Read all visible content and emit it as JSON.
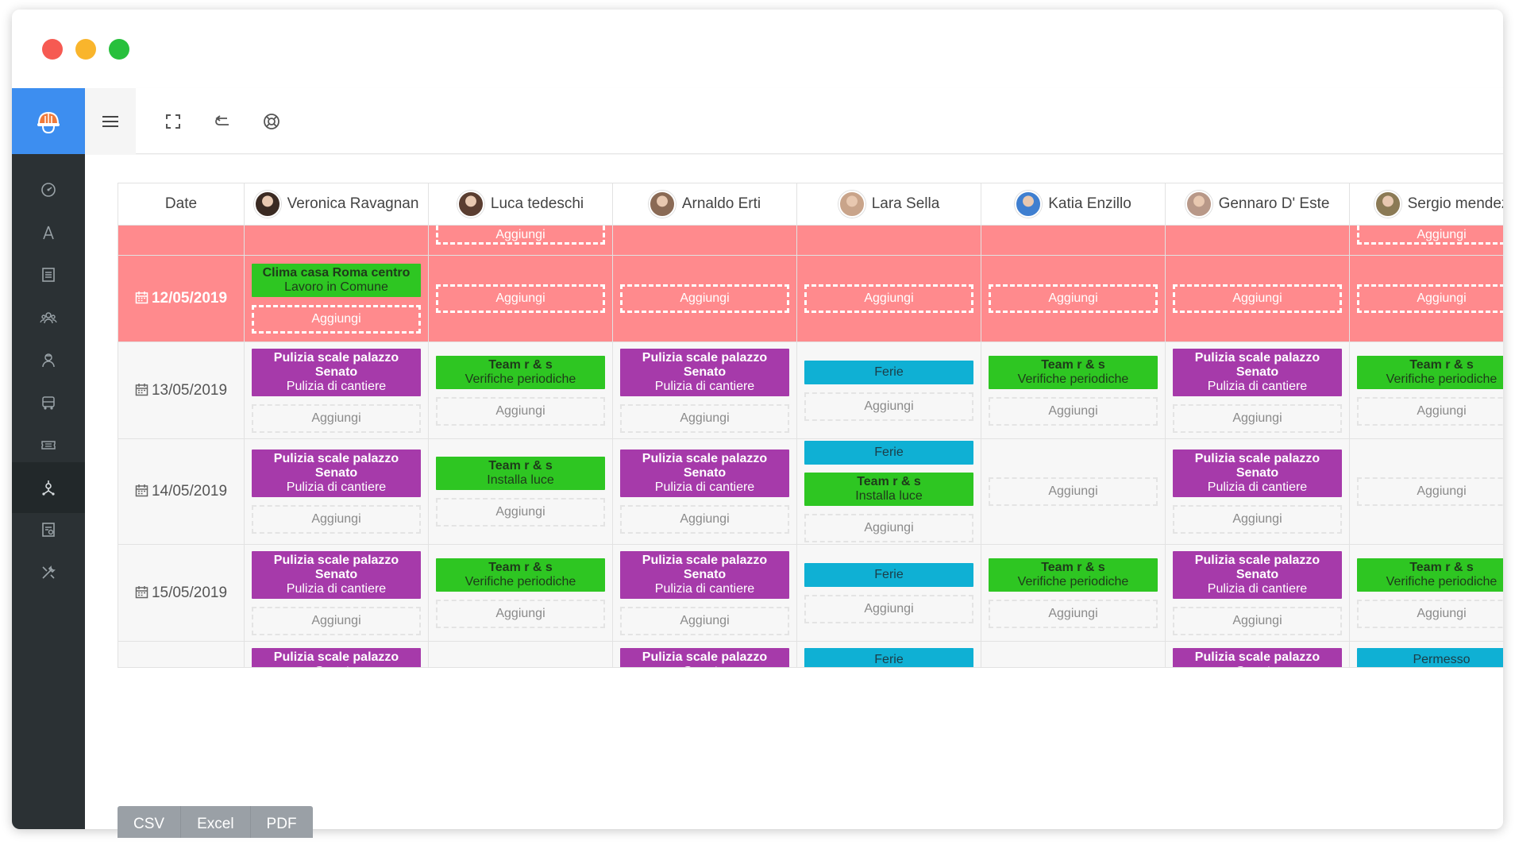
{
  "window": {
    "controls": [
      "close",
      "minimize",
      "maximize"
    ]
  },
  "sidebar": {
    "brand_icon": "helmet-icon",
    "items": [
      {
        "name": "dashboard",
        "icon": "gauge-icon"
      },
      {
        "name": "tools",
        "icon": "compass-icon"
      },
      {
        "name": "documents",
        "icon": "list-icon"
      },
      {
        "name": "team",
        "icon": "group-icon"
      },
      {
        "name": "workers",
        "icon": "worker-icon"
      },
      {
        "name": "vehicles",
        "icon": "truck-icon"
      },
      {
        "name": "tickets",
        "icon": "ticket-icon"
      },
      {
        "name": "planning",
        "icon": "org-icon",
        "active": true
      },
      {
        "name": "reports",
        "icon": "report-icon"
      },
      {
        "name": "settings",
        "icon": "wrench-icon"
      }
    ]
  },
  "toolbar": {
    "icons": [
      "menu-icon",
      "fullscreen-icon",
      "undo-icon",
      "support-icon"
    ]
  },
  "table": {
    "date_header": "Date",
    "employees": [
      {
        "name": "Veronica Ravagnan",
        "avatar_color": "#3a2a22"
      },
      {
        "name": "Luca tedeschi",
        "avatar_color": "#5a3d30"
      },
      {
        "name": "Arnaldo Erti",
        "avatar_color": "#8a6a55"
      },
      {
        "name": "Lara Sella",
        "avatar_color": "#c9a48a"
      },
      {
        "name": "Katia Enzillo",
        "avatar_color": "#3f7fd0"
      },
      {
        "name": "Gennaro D' Este",
        "avatar_color": "#b89888"
      },
      {
        "name": "Sergio mendez",
        "avatar_color": "#8b7a55"
      }
    ],
    "add_label": "Aggiungi",
    "rows": [
      {
        "date": "",
        "style": "red",
        "cells": [
          {
            "events": [],
            "add": false
          },
          {
            "events": [],
            "add": true,
            "add_top": true
          },
          {
            "events": [],
            "add": false
          },
          {
            "events": [],
            "add": false
          },
          {
            "events": [],
            "add": false
          },
          {
            "events": [],
            "add": false
          },
          {
            "events": [],
            "add": true,
            "add_top": true
          }
        ]
      },
      {
        "date": "12/05/2019",
        "style": "red",
        "cells": [
          {
            "events": [
              {
                "color": "green",
                "title": "Clima casa Roma centro",
                "sub": "Lavoro in Comune"
              }
            ],
            "add": true
          },
          {
            "events": [],
            "add": true
          },
          {
            "events": [],
            "add": true
          },
          {
            "events": [],
            "add": true
          },
          {
            "events": [],
            "add": true
          },
          {
            "events": [],
            "add": true
          },
          {
            "events": [],
            "add": true
          }
        ]
      },
      {
        "date": "13/05/2019",
        "style": "normal",
        "cells": [
          {
            "events": [
              {
                "color": "purple",
                "title": "Pulizia scale palazzo Senato",
                "sub": "Pulizia di cantiere"
              }
            ],
            "add": true
          },
          {
            "events": [
              {
                "color": "green",
                "title": "Team r & s",
                "sub": "Verifiche periodiche"
              }
            ],
            "add": true
          },
          {
            "events": [
              {
                "color": "purple",
                "title": "Pulizia scale palazzo Senato",
                "sub": "Pulizia di cantiere"
              }
            ],
            "add": true
          },
          {
            "events": [
              {
                "color": "cyan",
                "title": "",
                "sub": "Ferie"
              }
            ],
            "add": true
          },
          {
            "events": [
              {
                "color": "green",
                "title": "Team r & s",
                "sub": "Verifiche periodiche"
              }
            ],
            "add": true
          },
          {
            "events": [
              {
                "color": "purple",
                "title": "Pulizia scale palazzo Senato",
                "sub": "Pulizia di cantiere"
              }
            ],
            "add": true
          },
          {
            "events": [
              {
                "color": "green",
                "title": "Team r & s",
                "sub": "Verifiche periodiche"
              }
            ],
            "add": true
          }
        ]
      },
      {
        "date": "14/05/2019",
        "style": "normal",
        "cells": [
          {
            "events": [
              {
                "color": "purple",
                "title": "Pulizia scale palazzo Senato",
                "sub": "Pulizia di cantiere"
              }
            ],
            "add": true
          },
          {
            "events": [
              {
                "color": "green",
                "title": "Team r & s",
                "sub": "Installa luce"
              }
            ],
            "add": true
          },
          {
            "events": [
              {
                "color": "purple",
                "title": "Pulizia scale palazzo Senato",
                "sub": "Pulizia di cantiere"
              }
            ],
            "add": true
          },
          {
            "events": [
              {
                "color": "cyan",
                "title": "",
                "sub": "Ferie"
              },
              {
                "color": "green",
                "title": "Team r & s",
                "sub": "Installa luce"
              }
            ],
            "add": true
          },
          {
            "events": [],
            "add": true
          },
          {
            "events": [
              {
                "color": "purple",
                "title": "Pulizia scale palazzo Senato",
                "sub": "Pulizia di cantiere"
              }
            ],
            "add": true
          },
          {
            "events": [],
            "add": true
          }
        ]
      },
      {
        "date": "15/05/2019",
        "style": "normal",
        "cells": [
          {
            "events": [
              {
                "color": "purple",
                "title": "Pulizia scale palazzo Senato",
                "sub": "Pulizia di cantiere"
              }
            ],
            "add": true
          },
          {
            "events": [
              {
                "color": "green",
                "title": "Team r & s",
                "sub": "Verifiche periodiche"
              }
            ],
            "add": true
          },
          {
            "events": [
              {
                "color": "purple",
                "title": "Pulizia scale palazzo Senato",
                "sub": "Pulizia di cantiere"
              }
            ],
            "add": true
          },
          {
            "events": [
              {
                "color": "cyan",
                "title": "",
                "sub": "Ferie"
              }
            ],
            "add": true
          },
          {
            "events": [
              {
                "color": "green",
                "title": "Team r & s",
                "sub": "Verifiche periodiche"
              }
            ],
            "add": true
          },
          {
            "events": [
              {
                "color": "purple",
                "title": "Pulizia scale palazzo Senato",
                "sub": "Pulizia di cantiere"
              }
            ],
            "add": true
          },
          {
            "events": [
              {
                "color": "green",
                "title": "Team r & s",
                "sub": "Verifiche periodiche"
              }
            ],
            "add": true
          }
        ]
      },
      {
        "date": "",
        "style": "normal",
        "partial": true,
        "cells": [
          {
            "events": [
              {
                "color": "purple",
                "title": "Pulizia scale palazzo Senato",
                "sub": ""
              }
            ],
            "add": false
          },
          {
            "events": [],
            "add": false
          },
          {
            "events": [
              {
                "color": "purple",
                "title": "Pulizia scale palazzo Senato",
                "sub": ""
              }
            ],
            "add": false
          },
          {
            "events": [
              {
                "color": "cyan",
                "title": "",
                "sub": "Ferie"
              }
            ],
            "add": false
          },
          {
            "events": [],
            "add": false
          },
          {
            "events": [
              {
                "color": "purple",
                "title": "Pulizia scale palazzo Senato",
                "sub": ""
              }
            ],
            "add": false
          },
          {
            "events": [
              {
                "color": "cyan",
                "title": "",
                "sub": "Permesso"
              }
            ],
            "add": false
          }
        ]
      }
    ]
  },
  "export": {
    "buttons": [
      "CSV",
      "Excel",
      "PDF"
    ]
  },
  "colors": {
    "accent": "#3d8ef0",
    "sidebar": "#2b3134",
    "holiday_row": "#ff8a8d",
    "purple": "#a63aaa",
    "green": "#2ec622",
    "cyan": "#0fb0d4"
  }
}
